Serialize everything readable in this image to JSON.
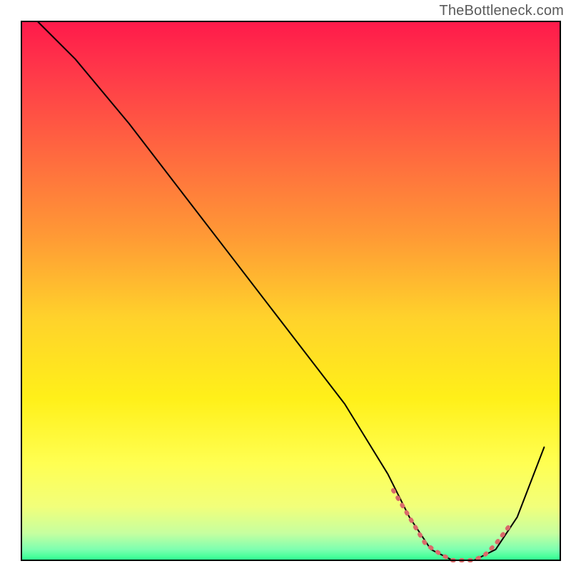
{
  "watermark": "TheBottleneck.com",
  "chart_data": {
    "type": "line",
    "title": "",
    "xlabel": "",
    "ylabel": "",
    "xlim": [
      0,
      100
    ],
    "ylim": [
      0,
      100
    ],
    "grid": false,
    "background_gradient": {
      "stops": [
        {
          "offset": 0.0,
          "color": "#ff1a4b"
        },
        {
          "offset": 0.1,
          "color": "#ff3a49"
        },
        {
          "offset": 0.25,
          "color": "#ff6a3f"
        },
        {
          "offset": 0.4,
          "color": "#ff9a35"
        },
        {
          "offset": 0.55,
          "color": "#ffd22b"
        },
        {
          "offset": 0.7,
          "color": "#fff019"
        },
        {
          "offset": 0.82,
          "color": "#ffff52"
        },
        {
          "offset": 0.9,
          "color": "#f2ff7a"
        },
        {
          "offset": 0.95,
          "color": "#c6ffa0"
        },
        {
          "offset": 0.98,
          "color": "#7dffb0"
        },
        {
          "offset": 1.0,
          "color": "#2cff8f"
        }
      ]
    },
    "series": [
      {
        "name": "bottleneck-curve",
        "stroke": "#000000",
        "stroke_width": 2,
        "x": [
          3,
          10,
          20,
          30,
          40,
          50,
          60,
          68,
          72,
          76,
          80,
          84,
          88,
          92,
          97
        ],
        "values": [
          100,
          93,
          81,
          68,
          55,
          42,
          29,
          16,
          8,
          2,
          0,
          0,
          2,
          8,
          21
        ]
      },
      {
        "name": "highlight-bottom",
        "stroke": "#d96a6a",
        "stroke_width": 6,
        "x": [
          69,
          72,
          75,
          78,
          80,
          82,
          84,
          86,
          88,
          91
        ],
        "values": [
          13,
          8,
          3,
          1,
          0,
          0,
          0,
          1,
          3,
          7
        ]
      }
    ]
  }
}
